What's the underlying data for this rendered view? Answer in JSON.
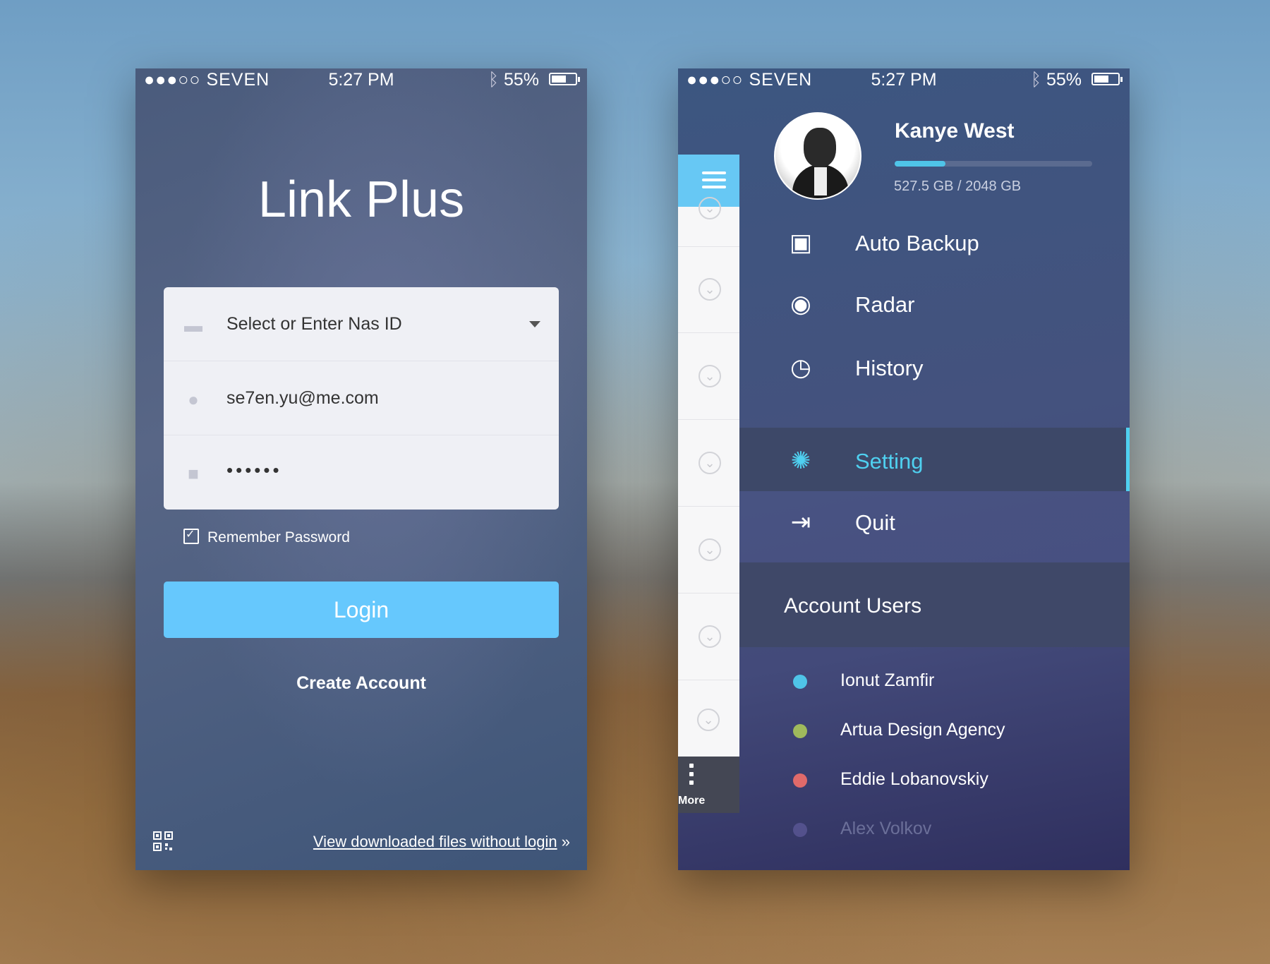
{
  "status_bar": {
    "carrier": "●●●○○ SEVEN",
    "time": "5:27 PM",
    "battery_pct": "55%",
    "battery_level": 0.55,
    "bluetooth_icon": "bluetooth-icon",
    "wifi_icon": "wifi-icon"
  },
  "login": {
    "app_title": "Link Plus",
    "nas_field": {
      "value": "Select or Enter Nas ID",
      "icon": "drive-icon"
    },
    "email_field": {
      "value": "se7en.yu@me.com",
      "icon": "user-icon"
    },
    "password_field": {
      "value": "••••••",
      "icon": "lock-icon"
    },
    "remember_label": "Remember Password",
    "remember_checked": true,
    "login_button": "Login",
    "create_account": "Create Account",
    "view_link": "View downloaded files without login",
    "view_link_arrows": "»",
    "qr_icon": "qr-code-icon"
  },
  "drawer": {
    "profile": {
      "name": "Kanye West",
      "quota_text": "527.5 GB / 2048 GB",
      "quota_used_fraction": 0.2576
    },
    "menu": [
      {
        "label": "Auto Backup",
        "icon": "image-sync-icon",
        "glyph": "▣"
      },
      {
        "label": "Radar",
        "icon": "radar-icon",
        "glyph": "◉"
      },
      {
        "label": "History",
        "icon": "clock-icon",
        "glyph": "◷"
      },
      {
        "label": "Setting",
        "icon": "gear-icon",
        "glyph": "✺",
        "active": true
      },
      {
        "label": "Quit",
        "icon": "exit-icon",
        "glyph": "⇥"
      }
    ],
    "account_users_title": "Account Users",
    "accounts": [
      {
        "name": "Ionut Zamfir",
        "color": "#4fc4e8"
      },
      {
        "name": "Artua Design Agency",
        "color": "#9fba5c"
      },
      {
        "name": "Eddie Lobanovskiy",
        "color": "#e06a6a"
      },
      {
        "name": "Alex Volkov",
        "color": "#8a7fd0",
        "dim": true
      }
    ],
    "rail": {
      "menu_icon": "hamburger-icon",
      "chevron_icon": "chevron-down-circle-icon",
      "more_label": "More"
    }
  },
  "colors": {
    "accent": "#4fd0f0",
    "login_button": "#66c8fd"
  }
}
